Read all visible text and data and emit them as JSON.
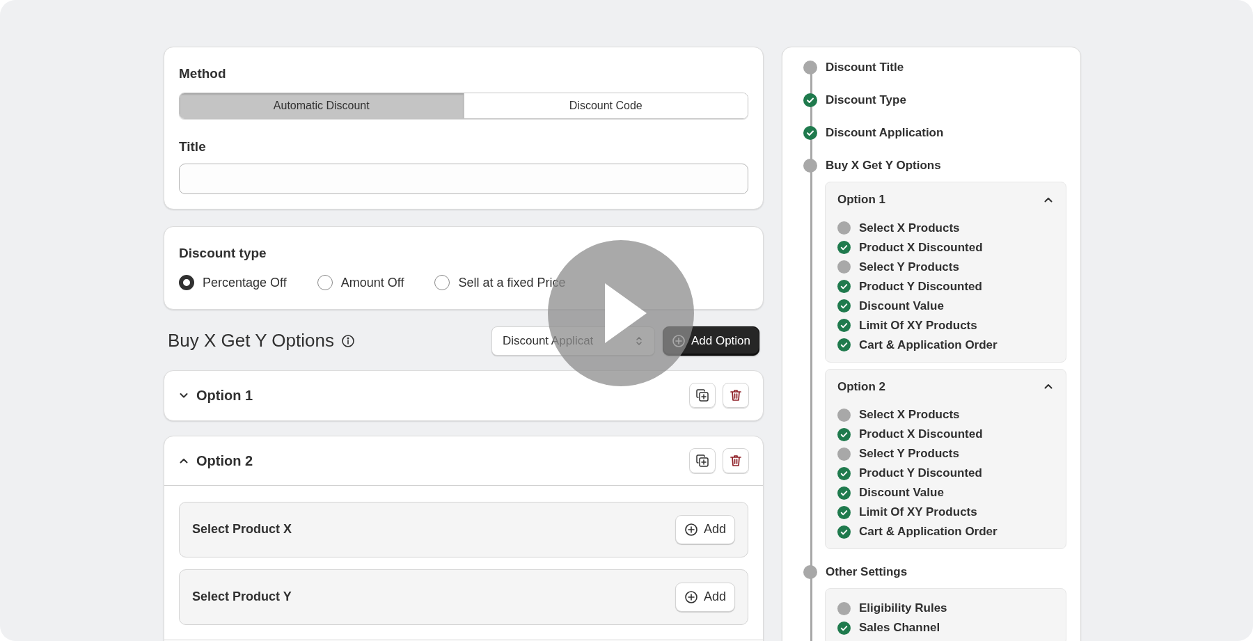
{
  "method": {
    "label": "Method",
    "segments": [
      {
        "label": "Automatic Discount",
        "selected": true
      },
      {
        "label": "Discount Code",
        "selected": false
      }
    ]
  },
  "title_field": {
    "label": "Title"
  },
  "discount_type": {
    "label": "Discount type",
    "options": [
      {
        "label": "Percentage Off",
        "selected": true
      },
      {
        "label": "Amount Off",
        "selected": false
      },
      {
        "label": "Sell at a fixed Price",
        "selected": false
      }
    ]
  },
  "options_header": {
    "title": "Buy X Get Y Options",
    "select": {
      "value": "Discount Applicat"
    },
    "add_button": "Add Option"
  },
  "option_cards": [
    {
      "title": "Option 1",
      "expanded": false
    },
    {
      "title": "Option 2",
      "expanded": true,
      "sections": [
        {
          "label": "Select Product X",
          "button": "Add"
        },
        {
          "label": "Select Product Y",
          "button": "Add"
        }
      ]
    }
  ],
  "progress": {
    "steps": [
      {
        "label": "Discount Title",
        "done": false
      },
      {
        "label": "Discount Type",
        "done": true
      },
      {
        "label": "Discount Application",
        "done": true
      },
      {
        "label": "Buy X Get Y Options",
        "done": false,
        "groups": [
          {
            "title": "Option 1",
            "expanded": true,
            "items": [
              {
                "label": "Select X Products",
                "done": false
              },
              {
                "label": "Product X Discounted",
                "done": true
              },
              {
                "label": "Select Y Products",
                "done": false
              },
              {
                "label": "Product Y Discounted",
                "done": true
              },
              {
                "label": "Discount Value",
                "done": true
              },
              {
                "label": "Limit Of XY Products",
                "done": true
              },
              {
                "label": "Cart & Application Order",
                "done": true
              }
            ]
          },
          {
            "title": "Option 2",
            "expanded": true,
            "items": [
              {
                "label": "Select X Products",
                "done": false
              },
              {
                "label": "Product X Discounted",
                "done": true
              },
              {
                "label": "Select Y Products",
                "done": false
              },
              {
                "label": "Product Y Discounted",
                "done": true
              },
              {
                "label": "Discount Value",
                "done": true
              },
              {
                "label": "Limit Of XY Products",
                "done": true
              },
              {
                "label": "Cart & Application Order",
                "done": true
              }
            ]
          }
        ]
      },
      {
        "label": "Other Settings",
        "done": false,
        "groups": [
          {
            "items": [
              {
                "label": "Eligibility Rules",
                "done": false
              },
              {
                "label": "Sales Channel",
                "done": true
              }
            ]
          }
        ]
      }
    ]
  }
}
